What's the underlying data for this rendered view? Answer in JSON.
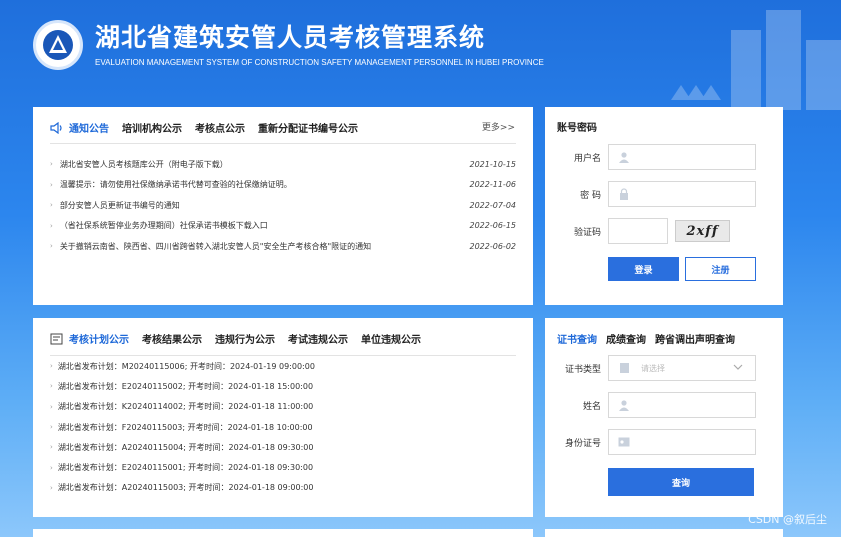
{
  "header": {
    "title": "湖北省建筑安管人员考核管理系统",
    "subtitle": "EVALUATION MANAGEMENT SYSTEM OF CONSTRUCTION SAFETY MANAGEMENT PERSONNEL IN HUBEI PROVINCE"
  },
  "notices": {
    "tabs": [
      "通知公告",
      "培训机构公示",
      "考核点公示",
      "重新分配证书编号公示"
    ],
    "more": "更多>>",
    "items": [
      {
        "text": "湖北省安管人员考核题库公开（附电子版下载）",
        "date": "2021-10-15"
      },
      {
        "text": "温馨提示：请勿使用社保缴纳承诺书代替可查验的社保缴纳证明。",
        "date": "2022-11-06"
      },
      {
        "text": "部分安管人员更新证书编号的通知",
        "date": "2022-07-04"
      },
      {
        "text": "（省社保系统暂停业务办理期间）社保承诺书模板下载入口",
        "date": "2022-06-15"
      },
      {
        "text": "关于撤销云南省、陕西省、四川省跨省转入湖北安管人员\"安全生产考核合格\"限证的通知",
        "date": "2022-06-02"
      }
    ]
  },
  "plans": {
    "tabs": [
      "考核计划公示",
      "考核结果公示",
      "违规行为公示",
      "考试违规公示",
      "单位违规公示"
    ],
    "items": [
      "湖北省发布计划：M20240115006; 开考时间：2024-01-19 09:00:00",
      "湖北省发布计划：E20240115002; 开考时间：2024-01-18 15:00:00",
      "湖北省发布计划：K20240114002; 开考时间：2024-01-18 11:00:00",
      "湖北省发布计划：F20240115003; 开考时间：2024-01-18 10:00:00",
      "湖北省发布计划：A20240115004; 开考时间：2024-01-18 09:30:00",
      "湖北省发布计划：E20240115001; 开考时间：2024-01-18 09:30:00",
      "湖北省发布计划：A20240115003; 开考时间：2024-01-18 09:00:00"
    ]
  },
  "login": {
    "title": "账号密码",
    "username_label": "用户名",
    "password_label": "密 码",
    "captcha_label": "验证码",
    "captcha_text": "2xff",
    "login_button": "登录",
    "register_button": "注册"
  },
  "query": {
    "tabs": [
      "证书查询",
      "成绩查询",
      "跨省调出声明查询"
    ],
    "type_label": "证书类型",
    "type_placeholder": "请选择",
    "name_label": "姓名",
    "id_label": "身份证号",
    "query_button": "查询"
  },
  "watermark": "CSDN @叙后尘",
  "colors": {
    "accent": "#1d68d8",
    "button": "#2a6fde",
    "header_bg": "#1f6fdc"
  }
}
